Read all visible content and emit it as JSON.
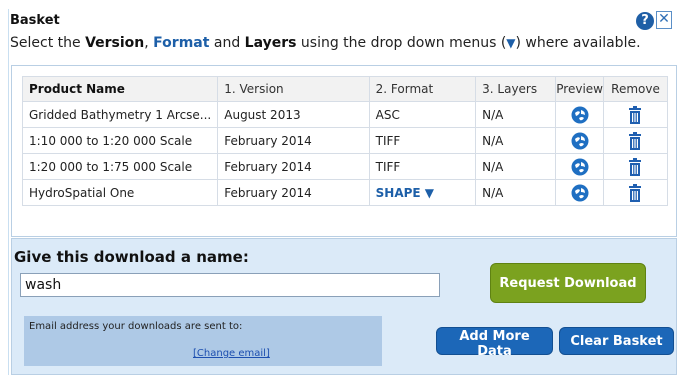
{
  "basket": {
    "title": "Basket",
    "help_label": "?",
    "close_label": "✕",
    "instructions": {
      "prefix": "Select the ",
      "version": "Version",
      "comma": ", ",
      "format": "Format",
      "and": " and ",
      "layers": "Layers",
      "suffix_before": " using the drop down menus (",
      "arrow": "▼",
      "suffix_after": ") where available."
    }
  },
  "table": {
    "headers": {
      "product_name": "Product Name",
      "version": "1. Version",
      "format": "2. Format",
      "layers": "3. Layers",
      "preview": "Preview",
      "remove": "Remove"
    },
    "rows": [
      {
        "product_name": "Gridded Bathymetry 1 Arcse...",
        "version": "August 2013",
        "format": "ASC",
        "layers": "N/A"
      },
      {
        "product_name": "1:10 000 to 1:20 000 Scale",
        "version": "February 2014",
        "format": "TIFF",
        "layers": "N/A"
      },
      {
        "product_name": "1:20 000 to 1:75 000 Scale",
        "version": "February 2014",
        "format": "TIFF",
        "layers": "N/A"
      },
      {
        "product_name": "HydroSpatial One",
        "version": "February 2014",
        "format": "SHAPE ▼",
        "layers": "N/A"
      }
    ]
  },
  "download": {
    "name_label": "Give this download a name:",
    "name_value": "wash",
    "request_button": "Request Download",
    "email_label": "Email address your downloads are sent to:",
    "change_email": "[Change email]",
    "add_more_button": "Add More Data",
    "clear_button": "Clear Basket"
  },
  "icons": {
    "help": "help-icon",
    "close": "close-icon",
    "preview": "globe-icon",
    "remove": "trash-icon"
  },
  "colors": {
    "accent_blue": "#1c67b8",
    "request_green": "#7ba21f",
    "panel_blue": "#dbeaf8"
  }
}
